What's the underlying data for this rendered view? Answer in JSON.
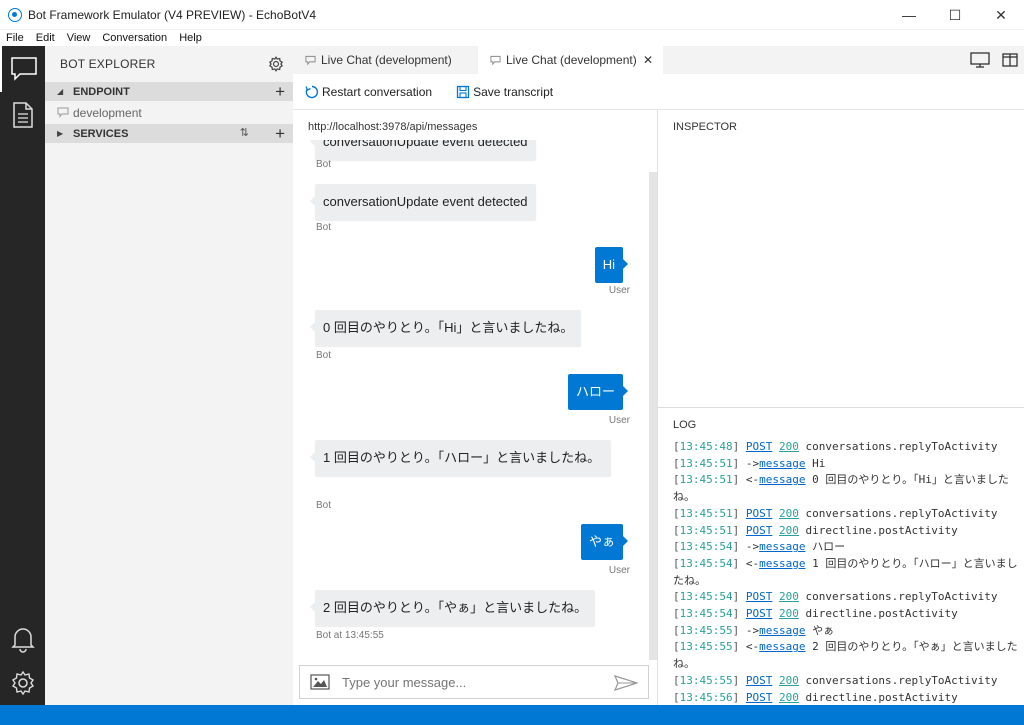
{
  "window": {
    "title": "Bot Framework Emulator (V4 PREVIEW) - EchoBotV4",
    "minimize": "—",
    "maximize": "☐",
    "close": "✕"
  },
  "menu": [
    "File",
    "Edit",
    "View",
    "Conversation",
    "Help"
  ],
  "explorer": {
    "title": "BOT EXPLORER",
    "endpoint_label": "ENDPOINT",
    "endpoint_item": "development",
    "services_label": "SERVICES",
    "sort_glyph": "⇅",
    "add_glyph": "+"
  },
  "tabs": [
    {
      "label": "Live Chat (development)"
    },
    {
      "label": "Live Chat (development)",
      "close": "✕"
    }
  ],
  "toolbar": {
    "restart": "Restart conversation",
    "save": "Save transcript"
  },
  "chat": {
    "url": "http://localhost:3978/api/messages",
    "messages": [
      {
        "from": "bot",
        "text": "conversationUpdate event detected",
        "meta": "Bot"
      },
      {
        "from": "bot",
        "text": "conversationUpdate event detected",
        "meta": "Bot"
      },
      {
        "from": "user",
        "text": "Hi",
        "meta": "User"
      },
      {
        "from": "bot",
        "text": "0 回目のやりとり。「Hi」と言いましたね。",
        "meta": "Bot"
      },
      {
        "from": "user",
        "text": "ハロー",
        "meta": "User"
      },
      {
        "from": "bot",
        "text": "1 回目のやりとり。「ハロー」と言いましたね。",
        "meta": "Bot"
      },
      {
        "from": "user",
        "text": "やぁ",
        "meta": "User"
      },
      {
        "from": "bot",
        "text": "2 回目のやりとり。「やぁ」と言いましたね。",
        "meta": "Bot at 13:45:55"
      }
    ],
    "input_placeholder": "Type your message..."
  },
  "inspector": {
    "title": "INSPECTOR"
  },
  "log": {
    "title": "LOG",
    "lines": [
      {
        "ts": "13:45:48",
        "a": "POST",
        "b": "200",
        "rest": "conversations.replyToActivity"
      },
      {
        "ts": "13:45:51",
        "dir": "->",
        "a": "message",
        "rest": "Hi"
      },
      {
        "ts": "13:45:51",
        "dir": "<-",
        "a": "message",
        "rest": "0 回目のやりとり。「Hi」と言いましたね。"
      },
      {
        "ts": "13:45:51",
        "a": "POST",
        "b": "200",
        "rest": "conversations.replyToActivity"
      },
      {
        "ts": "13:45:51",
        "a": "POST",
        "b": "200",
        "rest": "directline.postActivity"
      },
      {
        "ts": "13:45:54",
        "dir": "->",
        "a": "message",
        "rest": "ハロー"
      },
      {
        "ts": "13:45:54",
        "dir": "<-",
        "a": "message",
        "rest": "1 回目のやりとり。「ハロー」と言いましたね。"
      },
      {
        "ts": "13:45:54",
        "a": "POST",
        "b": "200",
        "rest": "conversations.replyToActivity"
      },
      {
        "ts": "13:45:54",
        "a": "POST",
        "b": "200",
        "rest": "directline.postActivity"
      },
      {
        "ts": "13:45:55",
        "dir": "->",
        "a": "message",
        "rest": "やぁ"
      },
      {
        "ts": "13:45:55",
        "dir": "<-",
        "a": "message",
        "rest": "2 回目のやりとり。「やぁ」と言いましたね。"
      },
      {
        "ts": "13:45:55",
        "a": "POST",
        "b": "200",
        "rest": "conversations.replyToActivity"
      },
      {
        "ts": "13:45:56",
        "a": "POST",
        "b": "200",
        "rest": "directline.postActivity"
      }
    ]
  },
  "colors": {
    "accent": "#0078d4",
    "nav_bg": "#262626",
    "log_timestamp": "#2aa198"
  }
}
